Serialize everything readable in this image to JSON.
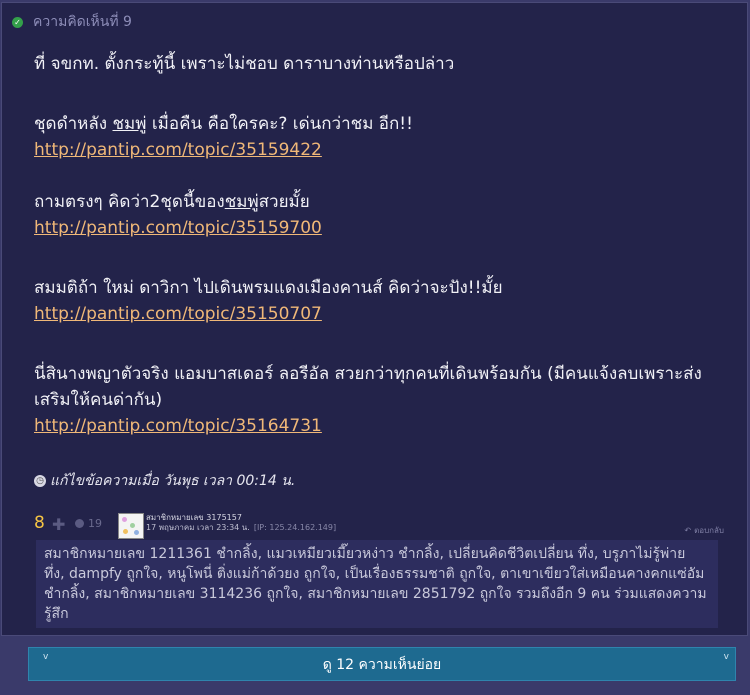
{
  "comment": {
    "number_label": "ความคิดเห็นที่ 9",
    "paragraphs": {
      "p1": "ที่ จขกท. ตั้งกระทู้นี้ เพราะไม่ชอบ ดาราบางท่านหรือปล่าว",
      "p2a": "ชุดดำหลัง ",
      "p2b": "ชมพู่",
      "p2c": " เมื่อคืน คือใครคะ? เด่นกว่าชม อีก!!",
      "link1": "http://pantip.com/topic/35159422",
      "p3a": "ถามตรงๆ คิดว่า2ชุดนี้ของ",
      "p3b": "ชมพู่",
      "p3c": "สวยมั้ย",
      "link2": "http://pantip.com/topic/35159700",
      "p4": "สมมติถ้า ใหม่ ดาวิกา ไปเดินพรมแดงเมืองคานส์ คิดว่าจะปัง!!มั้ย",
      "link3": "http://pantip.com/topic/35150707",
      "p5": "นี่สินางพญาตัวจริง แอมบาสเดอร์ ลอรีอัล สวยกว่าทุกคนที่เดินพร้อมกัน (มีคนแจ้งลบเพราะส่งเสริมให้คนด่ากัน)",
      "link4": "http://pantip.com/topic/35164731"
    },
    "edited": "แก้ไขข้อความเมื่อ วันพุธ เวลา 00:14 น.",
    "vote_count": "8",
    "emotion_count": "19",
    "member": "สมาชิกหมายเลข 3175157",
    "post_time": "17 พฤษภาคม เวลา 23:34 น.",
    "ip": "[IP: 125.24.162.149]",
    "reply_label": "ตอบกลับ",
    "likes_text": "สมาชิกหมายเลข 1211361 ชำกลิ้ง, แมวเหมียวเมี๊ยวหง่าว ชำกลิ้ง, เปลี่ยนคิดชีวิตเปลี่ยน ทึ่ง, บรูภาไม่รู้พ่าย ทึ่ง, dampfy ถูกใจ, หนูโพนี่ ติ่งแม่ก้าด้วยง ถูกใจ, เป็นเรื่องธรรมชาติ ถูกใจ, ตาเขาเขียวใส่เหมือนคางคกแซ่อัม ชำกลิ้ง, สมาชิกหมายเลข 3114236 ถูกใจ, สมาชิกหมายเลข 2851792 ถูกใจ รวมถึงอีก 9 คน ร่วมแสดงความรู้สึก"
  },
  "more_button_label": "ดู 12 ความเห็นย่อย",
  "icons": {
    "check": "check-circle-icon",
    "edit": "clock-icon",
    "plus": "plus-icon",
    "emotion": "emotion-icon",
    "reply": "reply-arrow-icon",
    "chevron": "chevron-down-icon"
  },
  "colors": {
    "background": "#3a3a6a",
    "card": "#23234a",
    "link": "#f0b878",
    "vote": "#f6c544",
    "button": "#1e6a90"
  }
}
